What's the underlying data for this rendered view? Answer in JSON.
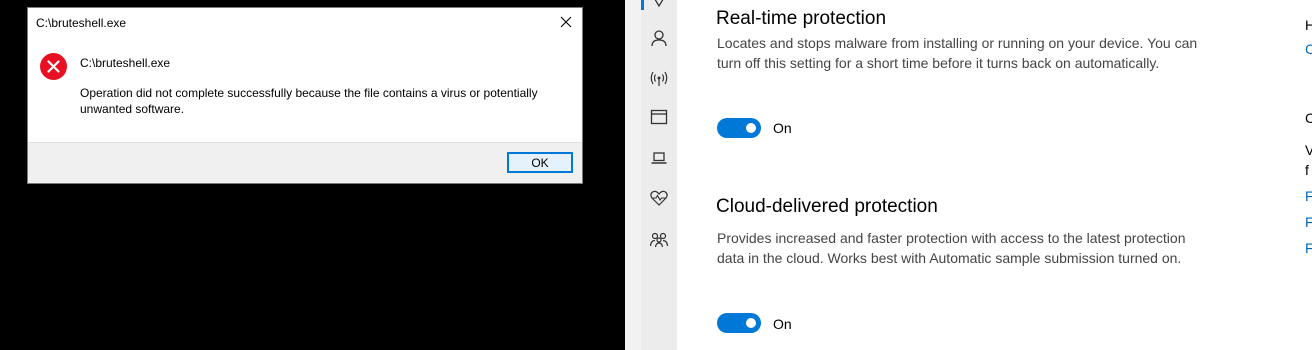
{
  "dialog": {
    "title": "C:\\bruteshell.exe",
    "heading": "C:\\bruteshell.exe",
    "message": "Operation did not complete successfully because the file contains a virus or potentially unwanted software.",
    "ok_label": "OK",
    "icon": "error-icon"
  },
  "nav": {
    "items": [
      "shield-icon",
      "person-icon",
      "wifi-icon",
      "app-browser-icon",
      "laptop-icon",
      "health-heart-icon",
      "family-icon"
    ]
  },
  "realtime": {
    "title": "Real-time protection",
    "description": "Locates and stops malware from installing or running on your device. You can turn off this setting for a short time before it turns back on automatically.",
    "state": "On"
  },
  "cloud": {
    "title": "Cloud-delivered protection",
    "description": "Provides increased and faster protection with access to the latest protection data in the cloud. Works best with Automatic sample submission turned on.",
    "state": "On"
  },
  "side": {
    "letters": [
      "H",
      "C",
      "C",
      "V",
      "f",
      "F",
      "F",
      "F"
    ]
  },
  "colors": {
    "accent": "#0078d7",
    "error": "#e81123",
    "link": "#0067b8"
  }
}
